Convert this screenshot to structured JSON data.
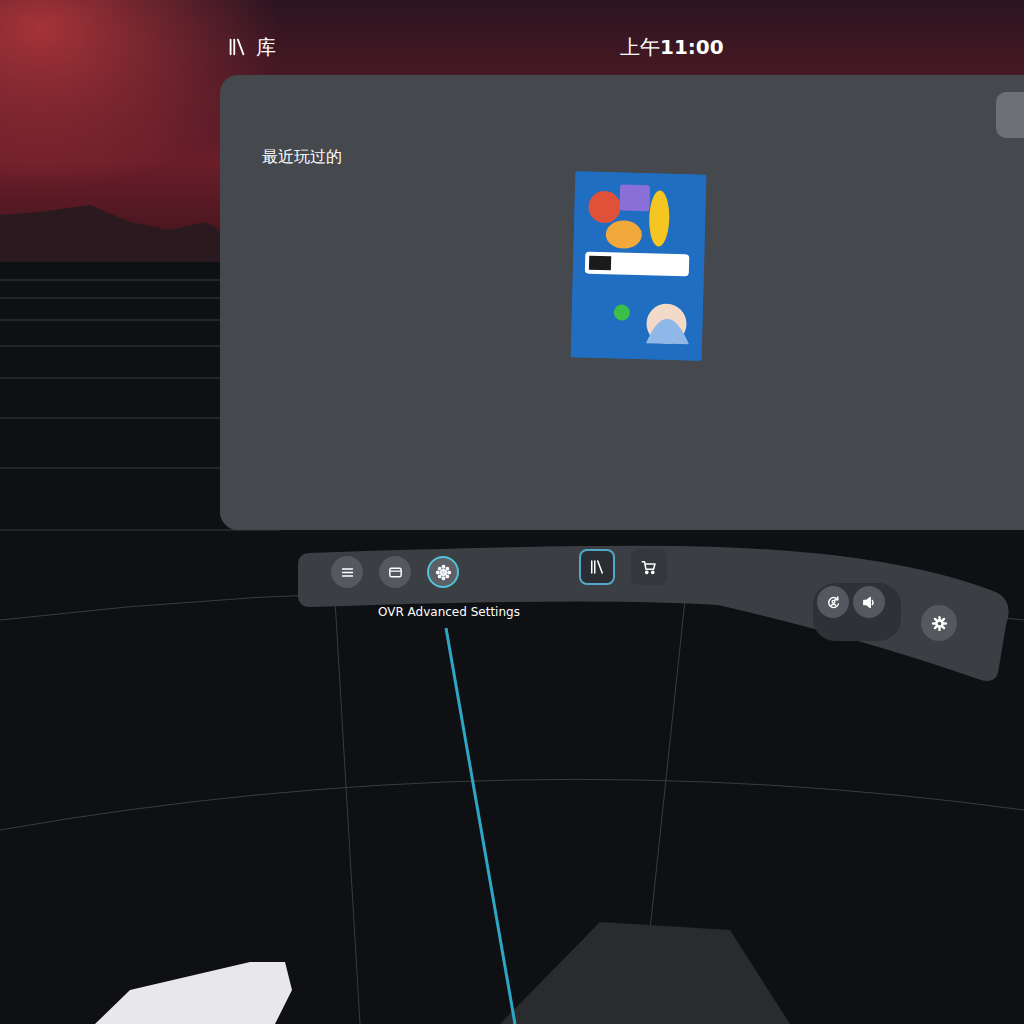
{
  "header": {
    "title": "库",
    "time_prefix": "上午",
    "time": "11:00"
  },
  "library": {
    "section": "最近玩过的"
  },
  "taskbar": {
    "left": [
      {
        "kind": "menu",
        "hovered": false
      },
      {
        "kind": "window",
        "hovered": false
      },
      {
        "kind": "app",
        "hovered": true
      }
    ],
    "center": [
      {
        "kind": "library",
        "selected": true
      },
      {
        "kind": "store",
        "selected": false
      }
    ],
    "right": [
      {
        "kind": "recenter"
      },
      {
        "kind": "volume"
      },
      {
        "kind": "settings"
      }
    ]
  },
  "tooltip": {
    "text": "OVR Advanced Settings"
  }
}
